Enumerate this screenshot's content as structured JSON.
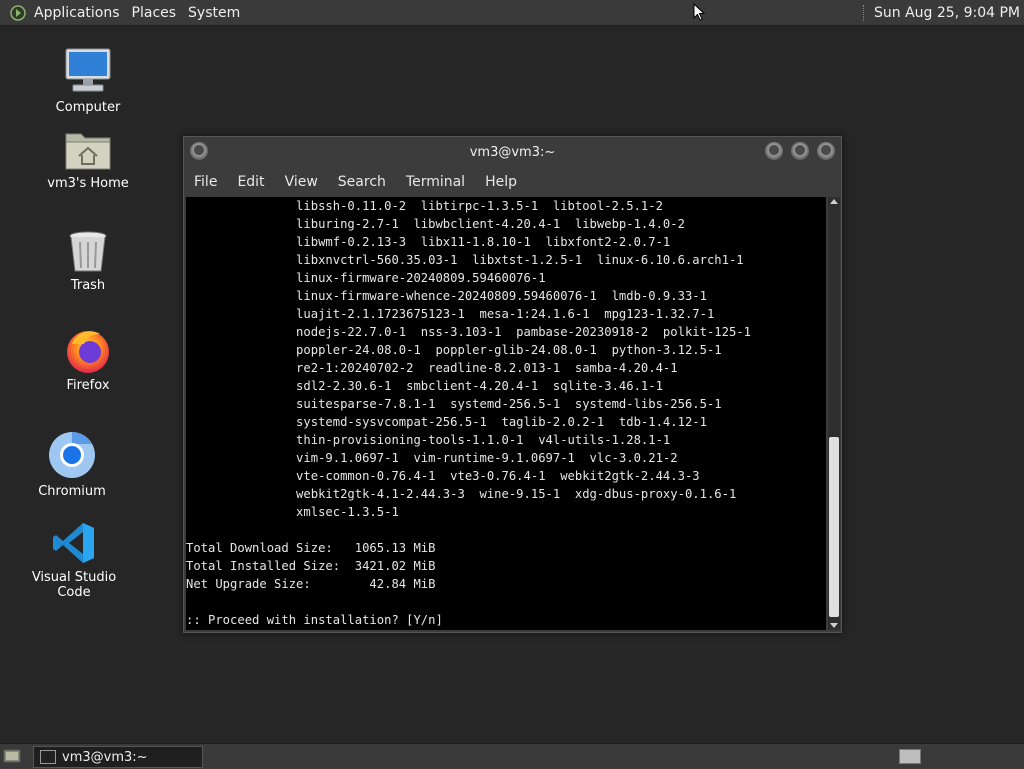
{
  "top_panel": {
    "menus": [
      "Applications",
      "Places",
      "System"
    ],
    "clock": "Sun Aug 25,  9:04 PM"
  },
  "desktop": {
    "icons": [
      {
        "label": "Computer",
        "icon": "computer-icon"
      },
      {
        "label": "vm3's Home",
        "icon": "home-folder-icon"
      },
      {
        "label": "Trash",
        "icon": "trash-icon"
      },
      {
        "label": "Firefox",
        "icon": "firefox-icon"
      },
      {
        "label": "Chromium",
        "icon": "chromium-icon"
      },
      {
        "label": "Visual Studio Code",
        "icon": "vscode-icon"
      }
    ]
  },
  "terminal": {
    "title": "vm3@vm3:~",
    "menu": [
      "File",
      "Edit",
      "View",
      "Search",
      "Terminal",
      "Help"
    ],
    "lines": [
      "               libssh-0.11.0-2  libtirpc-1.3.5-1  libtool-2.5.1-2",
      "               liburing-2.7-1  libwbclient-4.20.4-1  libwebp-1.4.0-2",
      "               libwmf-0.2.13-3  libx11-1.8.10-1  libxfont2-2.0.7-1",
      "               libxnvctrl-560.35.03-1  libxtst-1.2.5-1  linux-6.10.6.arch1-1",
      "               linux-firmware-20240809.59460076-1",
      "               linux-firmware-whence-20240809.59460076-1  lmdb-0.9.33-1",
      "               luajit-2.1.1723675123-1  mesa-1:24.1.6-1  mpg123-1.32.7-1",
      "               nodejs-22.7.0-1  nss-3.103-1  pambase-20230918-2  polkit-125-1",
      "               poppler-24.08.0-1  poppler-glib-24.08.0-1  python-3.12.5-1",
      "               re2-1:20240702-2  readline-8.2.013-1  samba-4.20.4-1",
      "               sdl2-2.30.6-1  smbclient-4.20.4-1  sqlite-3.46.1-1",
      "               suitesparse-7.8.1-1  systemd-256.5-1  systemd-libs-256.5-1",
      "               systemd-sysvcompat-256.5-1  taglib-2.0.2-1  tdb-1.4.12-1",
      "               thin-provisioning-tools-1.1.0-1  v4l-utils-1.28.1-1",
      "               vim-9.1.0697-1  vim-runtime-9.1.0697-1  vlc-3.0.21-2",
      "               vte-common-0.76.4-1  vte3-0.76.4-1  webkit2gtk-2.44.3-3",
      "               webkit2gtk-4.1-2.44.3-3  wine-9.15-1  xdg-dbus-proxy-0.1.6-1",
      "               xmlsec-1.3.5-1",
      "",
      "Total Download Size:   1065.13 MiB",
      "Total Installed Size:  3421.02 MiB",
      "Net Upgrade Size:        42.84 MiB",
      "",
      ":: Proceed with installation? [Y/n]"
    ]
  },
  "taskbar": {
    "task_label": "vm3@vm3:~"
  }
}
